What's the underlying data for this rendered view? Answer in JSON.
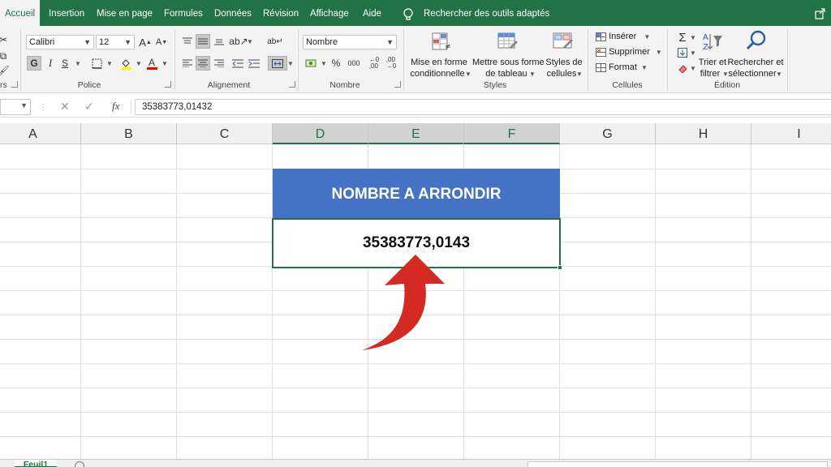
{
  "menu": {
    "tabs": [
      "Accueil",
      "Insertion",
      "Mise en page",
      "Formules",
      "Données",
      "Révision",
      "Affichage",
      "Aide"
    ],
    "search_label": "Rechercher des outils adaptés"
  },
  "ribbon": {
    "clipboard_label_fragment": "rs",
    "police": {
      "group_label": "Police",
      "font_name": "Calibri",
      "font_size": "12",
      "bold": "G",
      "italic": "I",
      "underline": "S",
      "grow": "A",
      "shrink": "A",
      "font_color": "A"
    },
    "alignment": {
      "group_label": "Alignement"
    },
    "number": {
      "group_label": "Nombre",
      "format": "Nombre",
      "percent": "%",
      "thousands": "000"
    },
    "styles": {
      "group_label": "Styles",
      "conditional_line1": "Mise en forme",
      "conditional_line2": "conditionnelle",
      "table_line1": "Mettre sous forme",
      "table_line2": "de tableau",
      "cell_styles_line1": "Styles de",
      "cell_styles_line2": "cellules"
    },
    "cells": {
      "group_label": "Cellules",
      "insert": "Insérer",
      "delete": "Supprimer",
      "format": "Format"
    },
    "editing": {
      "group_label": "Édition",
      "sort_line1": "Trier et",
      "sort_line2": "filtrer",
      "find_line1": "Rechercher et",
      "find_line2": "sélectionner"
    }
  },
  "formula_bar": {
    "fx_label": "fx",
    "value": "35383773,01432"
  },
  "columns": [
    "A",
    "B",
    "C",
    "D",
    "E",
    "F",
    "G",
    "H",
    "I"
  ],
  "selected_columns": [
    "D",
    "E",
    "F"
  ],
  "table": {
    "header": "NOMBRE A ARRONDIR",
    "value": "35383773,0143"
  },
  "sheet_tab": "Feuil1",
  "colors": {
    "excel_green": "#217346",
    "header_blue": "#4472c4",
    "arrow_red": "#d42a24"
  }
}
